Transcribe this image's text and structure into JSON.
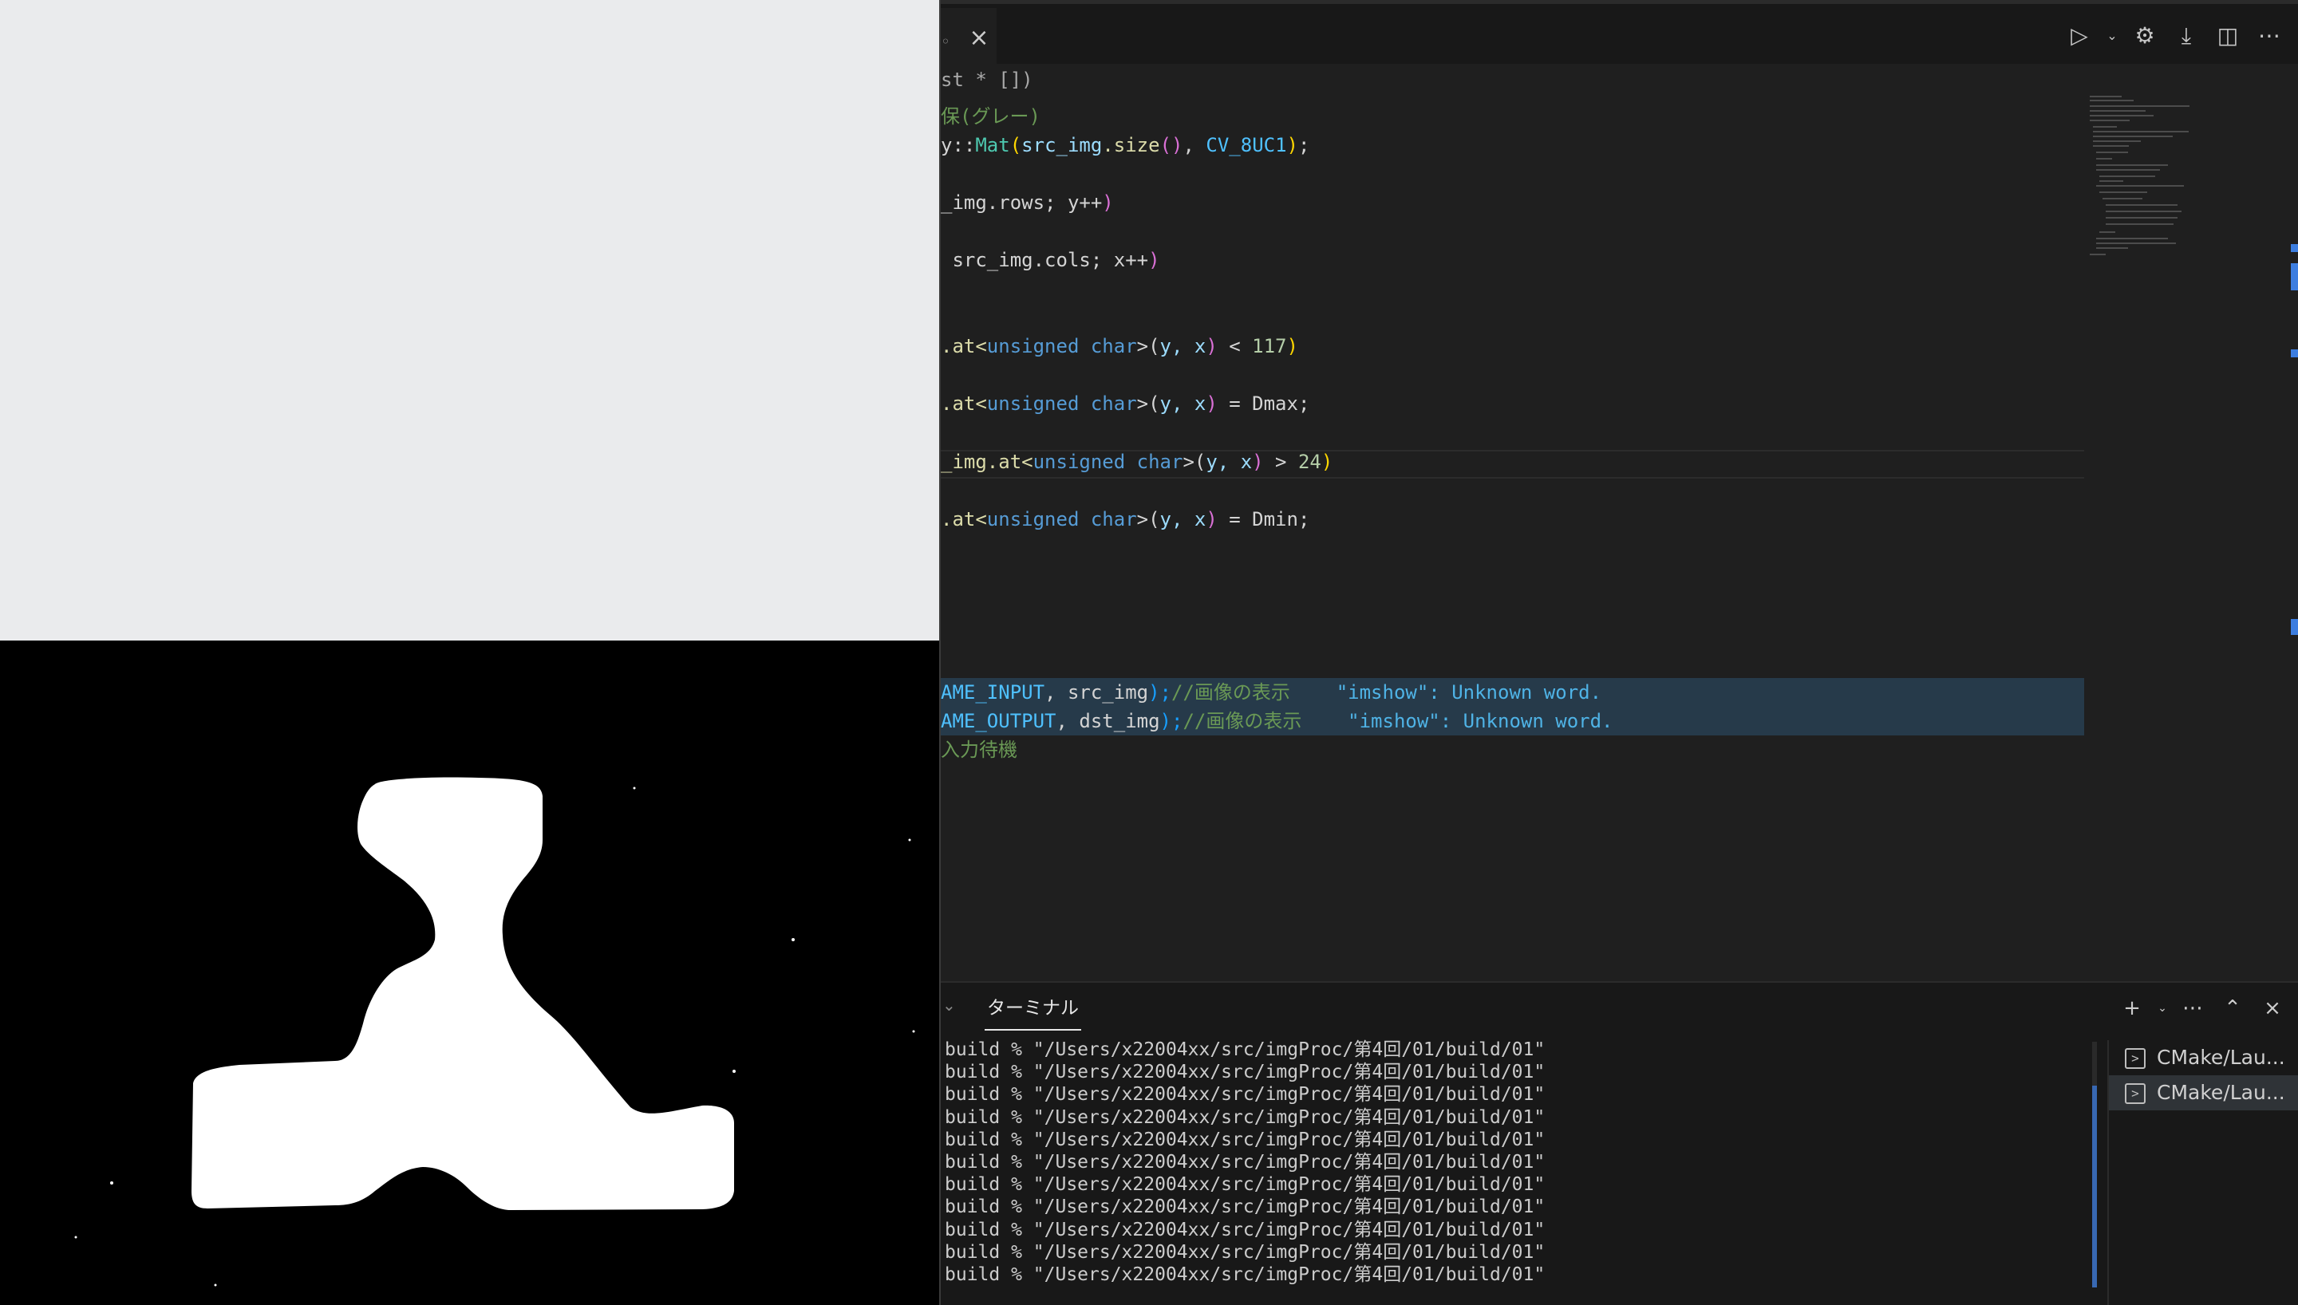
{
  "editor_tab": {
    "close_icon": "×"
  },
  "editor_actions": [
    {
      "name": "run-icon",
      "glyph": "▷"
    },
    {
      "name": "run-dropdown-icon",
      "glyph": "⌄"
    },
    {
      "name": "settings-gear-icon",
      "glyph": "⚙"
    },
    {
      "name": "download-icon",
      "glyph": "⤓"
    },
    {
      "name": "split-editor-icon",
      "glyph": "◫"
    },
    {
      "name": "more-actions-icon",
      "glyph": "⋯"
    }
  ],
  "breadcrumb": {
    "text": "st * [])"
  },
  "code": {
    "line1_comment": "保(グレー)",
    "line2_a": "y::",
    "line2_b": "Mat",
    "line2_c": "(",
    "line2_d": "src_img",
    "line2_e": ".size",
    "line2_f": "()",
    "line2_g": ", ",
    "line2_h": "CV_8UC1",
    "line2_i": ")",
    "line2_j": ";",
    "line3_a": "_img.rows; y++",
    "line3_b": ")",
    "line4_a": " src_img.cols; x++",
    "line4_b": ")",
    "line5_a": ".at<",
    "line5_b": "unsigned char",
    "line5_c": ">(",
    "line5_d": "y, x",
    "line5_e": ")",
    "line5_f": " < ",
    "line5_g": "117",
    "line5_h": ")",
    "line6_a": ".at<",
    "line6_b": "unsigned char",
    "line6_c": ">(",
    "line6_d": "y, x",
    "line6_e": ")",
    "line6_f": " = Dmax;",
    "line7_a": "_img.at<",
    "line7_b": "unsigned char",
    "line7_c": ">(",
    "line7_d": "y, x",
    "line7_e": ")",
    "line7_f": " > ",
    "line7_g": "24",
    "line7_h": ")",
    "line8_a": ".at<",
    "line8_b": "unsigned char",
    "line8_c": ">(",
    "line8_d": "y, x",
    "line8_e": ")",
    "line8_f": " = Dmin;",
    "line9_a": "AME_INPUT",
    "line9_b": ", src_img",
    "line9_c": ");",
    "line9_d": "//画像の表示",
    "line9_e": "\"imshow\": Unknown word.",
    "line10_a": "AME_OUTPUT",
    "line10_b": ", dst_img",
    "line10_c": ");",
    "line10_d": "//画像の表示",
    "line10_e": "\"imshow\": Unknown word.",
    "line11_comment": "入力待機"
  },
  "panel": {
    "prev_tab_glyph": "⌄",
    "active_tab": "ターミナル",
    "actions": [
      {
        "name": "new-terminal-icon",
        "glyph": "+"
      },
      {
        "name": "terminal-dropdown-icon",
        "glyph": "⌄"
      },
      {
        "name": "panel-more-icon",
        "glyph": "⋯"
      },
      {
        "name": "maximize-panel-icon",
        "glyph": "⌃"
      },
      {
        "name": "close-panel-icon",
        "glyph": "×"
      }
    ],
    "terminal_lines": [
      "build % \"/Users/x22004xx/src/imgProc/第4回/01/build/01\"",
      "build % \"/Users/x22004xx/src/imgProc/第4回/01/build/01\"",
      "build % \"/Users/x22004xx/src/imgProc/第4回/01/build/01\"",
      "build % \"/Users/x22004xx/src/imgProc/第4回/01/build/01\"",
      "build % \"/Users/x22004xx/src/imgProc/第4回/01/build/01\"",
      "build % \"/Users/x22004xx/src/imgProc/第4回/01/build/01\"",
      "build % \"/Users/x22004xx/src/imgProc/第4回/01/build/01\"",
      "build % \"/Users/x22004xx/src/imgProc/第4回/01/build/01\"",
      "build % \"/Users/x22004xx/src/imgProc/第4回/01/build/01\"",
      "build % \"/Users/x22004xx/src/imgProc/第4回/01/build/01\"",
      "build % \"/Users/x22004xx/src/imgProc/第4回/01/build/01\""
    ],
    "terminal_list": [
      {
        "label": "CMake/Lau...",
        "icon": ">",
        "active": false
      },
      {
        "label": "CMake/Lau...",
        "icon": ">",
        "active": true
      }
    ]
  },
  "colors": {
    "accent": "#3d7ee0",
    "image_top_bg": "#eaebed",
    "image_bottom_bg": "#000000",
    "shape_fill": "#ffffff"
  }
}
